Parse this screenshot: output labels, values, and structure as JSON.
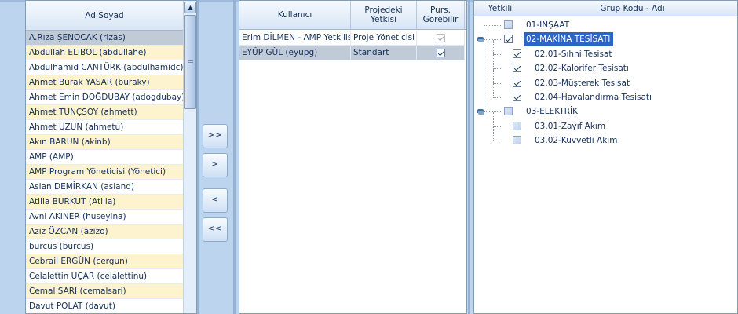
{
  "users": {
    "header": "Ad Soyad",
    "selected_index": 0,
    "items": [
      "A.Rıza ŞENOCAK (rizas)",
      "Abdullah ELİBOL (abdullahe)",
      "Abdülhamid CANTÜRK (abdülhamidc)",
      "Ahmet Burak YASAR (buraky)",
      "Ahmet Emin DOĞDUBAY (adogdubay)",
      "Ahmet TUNÇSOY (ahmett)",
      "Ahmet UZUN (ahmetu)",
      "Akın BARUN (akinb)",
      "AMP (AMP)",
      "AMP Program Yöneticisi (Yönetici)",
      "Aslan DEMİRKAN (asland)",
      "Atilla BURKUT (Atilla)",
      "Avni AKINER (huseyina)",
      "Aziz ÖZCAN (azizo)",
      "burcus (burcus)",
      "Cebrail ERGÜN (cergun)",
      "Celalettin UÇAR (celalettinu)",
      "Cemal SARI (cemalsari)",
      "Davut POLAT (davut)"
    ]
  },
  "transfer_buttons": {
    "add_all": ">>",
    "add": ">",
    "remove": "<",
    "remove_all": "<<"
  },
  "assigned": {
    "headers": {
      "user": "Kullanıcı",
      "role": "Projedeki Yetkisi",
      "visible": "Purs. Görebilir"
    },
    "rows": [
      {
        "user": "Erim DİLMEN - AMP Yetkilis",
        "role": "Proje Yöneticisi",
        "visible": true,
        "disabled": true,
        "selected": false
      },
      {
        "user": "EYÜP GÜL (eyupg)",
        "role": "Standart",
        "visible": true,
        "disabled": false,
        "selected": true
      }
    ]
  },
  "groups": {
    "headers": {
      "auth": "Yetkili",
      "code": "Grup Kodu - Adı"
    },
    "items": [
      {
        "label": "01-İNŞAAT",
        "level": 0,
        "checked": false,
        "expander": false,
        "selected": false,
        "empty": true
      },
      {
        "label": "02-MAKİNA TESİSATI",
        "level": 0,
        "checked": true,
        "expander": true,
        "selected": true,
        "empty": false
      },
      {
        "label": "02.01-Sıhhi Tesisat",
        "level": 1,
        "checked": true,
        "expander": false,
        "selected": false,
        "empty": false
      },
      {
        "label": "02.02-Kalorifer Tesisatı",
        "level": 1,
        "checked": true,
        "expander": false,
        "selected": false,
        "empty": false
      },
      {
        "label": "02.03-Müşterek Tesisat",
        "level": 1,
        "checked": true,
        "expander": false,
        "selected": false,
        "empty": false
      },
      {
        "label": "02.04-Havalandırma Tesisatı",
        "level": 1,
        "checked": true,
        "expander": false,
        "selected": false,
        "empty": false
      },
      {
        "label": "03-ELEKTRİK",
        "level": 0,
        "checked": false,
        "expander": true,
        "selected": false,
        "empty": true
      },
      {
        "label": "03.01-Zayıf Akım",
        "level": 1,
        "checked": false,
        "expander": false,
        "selected": false,
        "empty": true
      },
      {
        "label": "03.02-Kuvvetli Akım",
        "level": 1,
        "checked": false,
        "expander": false,
        "selected": false,
        "empty": true
      }
    ]
  },
  "icons": {
    "scroll_up": "chevron-up-icon",
    "scroll_grip": "grip-icon",
    "tree_expander": "expander-icon"
  }
}
